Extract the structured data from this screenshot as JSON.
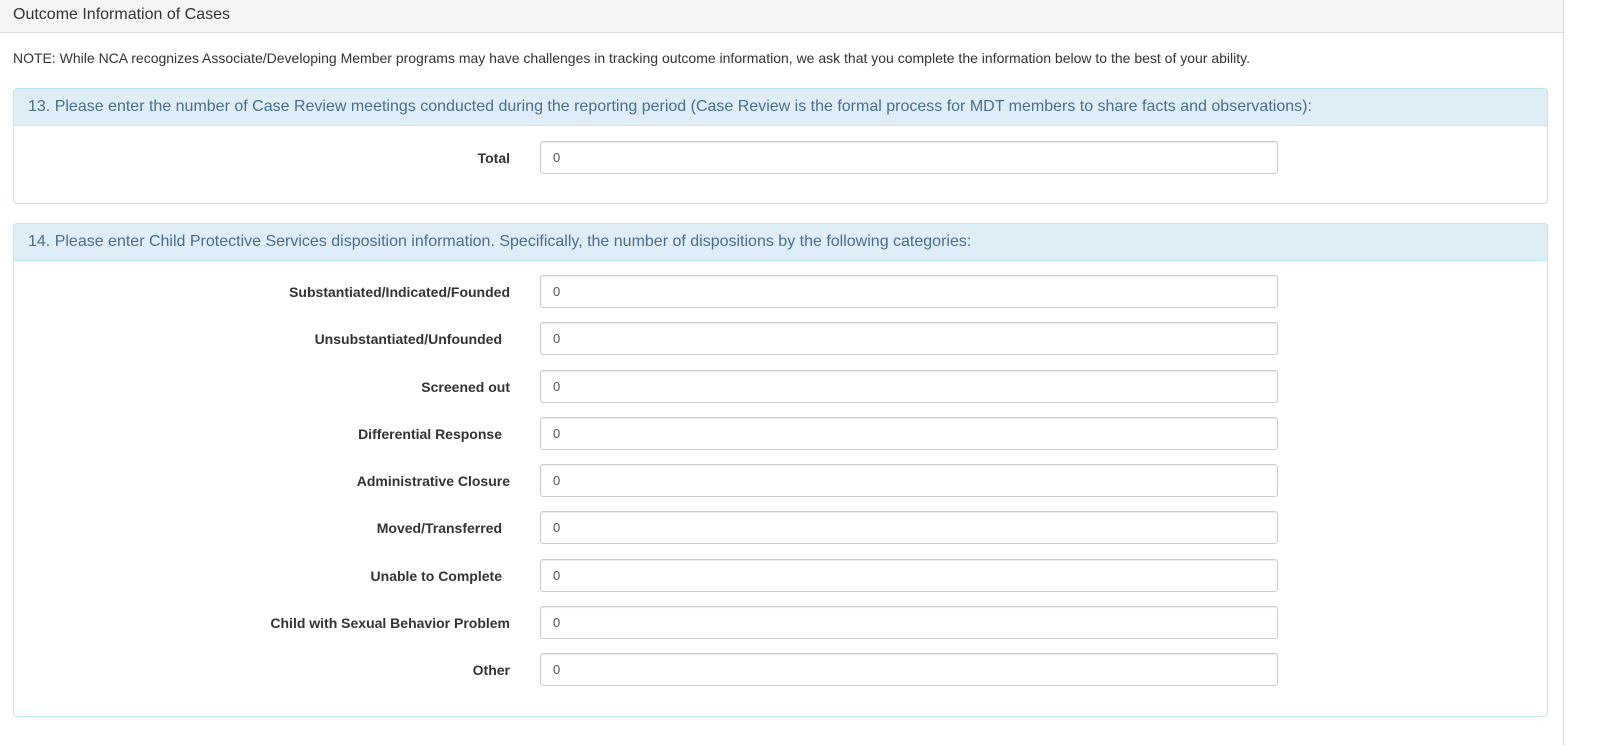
{
  "page": {
    "heading": "Outcome Information of Cases",
    "note": "NOTE: While NCA recognizes Associate/Developing Member programs may have challenges in tracking outcome information, we ask that you complete the information below to the best of your ability."
  },
  "q13": {
    "heading": "13. Please enter the number of Case Review meetings conducted during the reporting period (Case Review is the formal process for MDT members to share facts and observations):",
    "fields": [
      {
        "label": "Total",
        "value": "0"
      }
    ]
  },
  "q14": {
    "heading": "14. Please enter Child Protective Services disposition information. Specifically, the number of dispositions by the following categories:",
    "fields": [
      {
        "label": "Substantiated/Indicated/Founded",
        "value": "0"
      },
      {
        "label": "Unsubstantiated/Unfounded",
        "value": "0"
      },
      {
        "label": "Screened out",
        "value": "0"
      },
      {
        "label": "Differential Response",
        "value": "0"
      },
      {
        "label": "Administrative Closure",
        "value": "0"
      },
      {
        "label": "Moved/Transferred",
        "value": "0"
      },
      {
        "label": "Unable to Complete",
        "value": "0"
      },
      {
        "label": "Child with Sexual Behavior Problem",
        "value": "0"
      },
      {
        "label": "Other",
        "value": "0"
      }
    ]
  }
}
